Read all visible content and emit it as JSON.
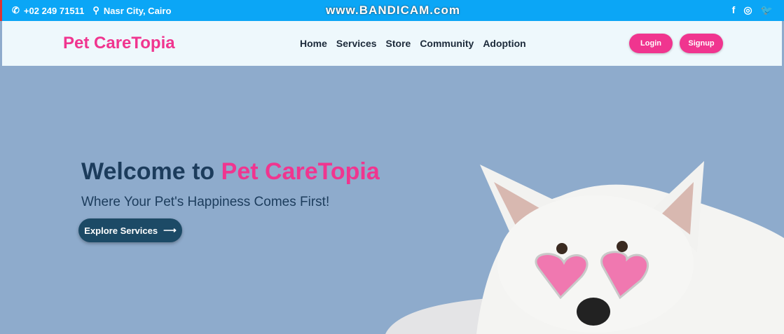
{
  "topbar": {
    "phone": "+02 249 71511",
    "location": "Nasr City, Cairo",
    "watermark": "www.BANDICAM.com",
    "social": [
      "facebook-icon",
      "instagram-icon",
      "twitter-icon"
    ]
  },
  "nav": {
    "logo": "Pet CareTopia",
    "items": [
      "Home",
      "Services",
      "Store",
      "Community",
      "Adoption"
    ],
    "login": "Login",
    "signup": "Signup"
  },
  "hero": {
    "title_prefix": "Welcome to ",
    "title_brand": "Pet CareTopia",
    "subtitle": "Where Your Pet's Happiness Comes First!",
    "cta": "Explore Services",
    "cta_arrow": "⟶"
  },
  "colors": {
    "accent": "#f0358f",
    "topbar": "#0ba6f6",
    "hero_bg": "#8eabcc",
    "dark": "#1c3c5c"
  }
}
